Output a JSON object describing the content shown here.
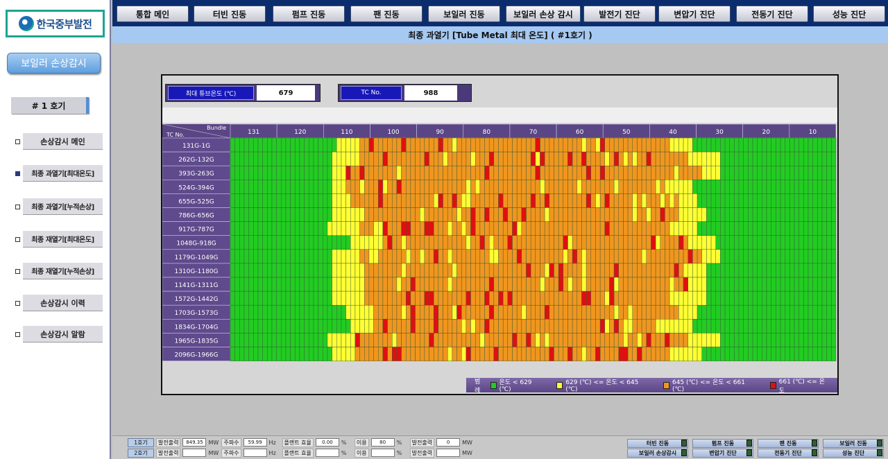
{
  "logo": {
    "text": "한국중부발전"
  },
  "sidebar": {
    "section_title": "보일러 손상감시",
    "unit": "# 1 호기",
    "items": [
      {
        "label": "손상감시 메인",
        "active": false
      },
      {
        "label": "최종 과열기[최대온도]",
        "active": true
      },
      {
        "label": "최종 과열기[누적손상]",
        "active": false
      },
      {
        "label": "최종 재열기[최대온도]",
        "active": false
      },
      {
        "label": "최종 재열기[누적손상]",
        "active": false
      },
      {
        "label": "손상감시 이력",
        "active": false
      },
      {
        "label": "손상감시 알람",
        "active": false
      }
    ]
  },
  "topnav": [
    "통합 메인",
    "터빈 진동",
    "펌프 진동",
    "팬 진동",
    "보일러 진동",
    "보일러 손상 감시",
    "발전기 진단",
    "변압기 진단",
    "전동기 진단",
    "성능 진단"
  ],
  "page_title": "최종 과열기 [Tube Metal 최대 온도] ( #1호기 )",
  "info": {
    "max_temp_label": "최대 튜브온도 (℃)",
    "max_temp_value": "679",
    "tc_label": "TC No.",
    "tc_value": "988"
  },
  "grid": {
    "corner_top": "Bundle",
    "corner_bottom": "TC No.",
    "bundles": [
      "131",
      "120",
      "110",
      "100",
      "90",
      "80",
      "70",
      "60",
      "50",
      "40",
      "30",
      "20",
      "10"
    ],
    "rows": [
      "131G-1G",
      "262G-132G",
      "393G-263G",
      "524G-394G",
      "655G-525G",
      "786G-656G",
      "917G-787G",
      "1048G-918G",
      "1179G-1049G",
      "1310G-1180G",
      "1141G-1311G",
      "1572G-1442G",
      "1703G-1573G",
      "1834G-1704G",
      "1965G-1835G",
      "2096G-1966G"
    ],
    "columns": 131,
    "colors": {
      "green": "#22cc22",
      "yellow": "#ffff33",
      "orange": "#f0961e",
      "red": "#e01010"
    }
  },
  "legend": {
    "title": "범례",
    "items": [
      {
        "color": "#22cc22",
        "label": "온도 < 629 (℃)"
      },
      {
        "color": "#ffff33",
        "label": "629 (℃) <= 온도 < 645 (℃)"
      },
      {
        "color": "#f0961e",
        "label": "645 (℃) <= 온도 < 661 (℃)"
      },
      {
        "color": "#e01010",
        "label": "661 (℃) <= 온도"
      }
    ]
  },
  "status": {
    "unit1": "1호기",
    "unit2": "2호기",
    "gen_output_label": "발전출력",
    "gen_output_1": "849.35",
    "mw": "MW",
    "freq_label": "주파수",
    "freq_1": "59.99",
    "hz": "Hz",
    "plant_eff_label": "플랜트 효율",
    "plant_eff_1": "0.00",
    "pct": "%",
    "util_label": "이용",
    "util_1": "80",
    "gen_output2_label": "발전출력",
    "gen_output2_1": "0",
    "buttons": [
      "터빈 진동",
      "펌프 진동",
      "팬 진동",
      "보일러 진동",
      "보일러 손상감시",
      "변압기 진단",
      "전동기 진단",
      "성능 진단"
    ]
  }
}
